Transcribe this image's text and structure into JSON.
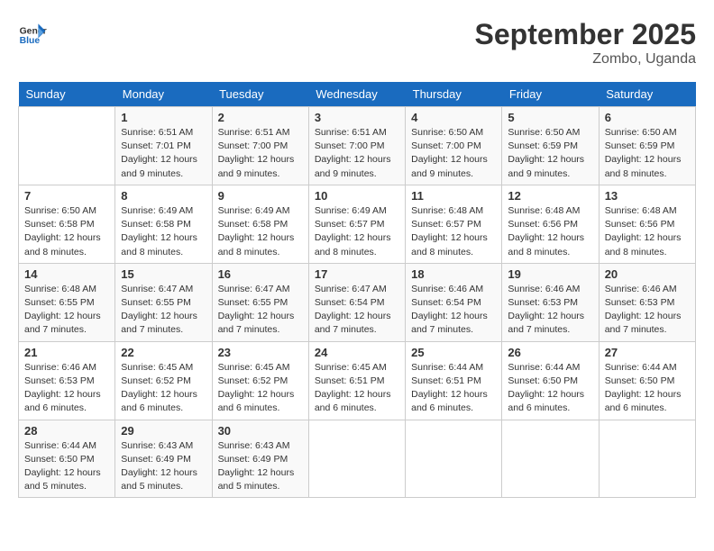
{
  "header": {
    "logo_line1": "General",
    "logo_line2": "Blue",
    "month_title": "September 2025",
    "location": "Zombo, Uganda"
  },
  "days_of_week": [
    "Sunday",
    "Monday",
    "Tuesday",
    "Wednesday",
    "Thursday",
    "Friday",
    "Saturday"
  ],
  "weeks": [
    [
      {
        "day": "",
        "info": ""
      },
      {
        "day": "1",
        "info": "Sunrise: 6:51 AM\nSunset: 7:01 PM\nDaylight: 12 hours\nand 9 minutes."
      },
      {
        "day": "2",
        "info": "Sunrise: 6:51 AM\nSunset: 7:00 PM\nDaylight: 12 hours\nand 9 minutes."
      },
      {
        "day": "3",
        "info": "Sunrise: 6:51 AM\nSunset: 7:00 PM\nDaylight: 12 hours\nand 9 minutes."
      },
      {
        "day": "4",
        "info": "Sunrise: 6:50 AM\nSunset: 7:00 PM\nDaylight: 12 hours\nand 9 minutes."
      },
      {
        "day": "5",
        "info": "Sunrise: 6:50 AM\nSunset: 6:59 PM\nDaylight: 12 hours\nand 9 minutes."
      },
      {
        "day": "6",
        "info": "Sunrise: 6:50 AM\nSunset: 6:59 PM\nDaylight: 12 hours\nand 8 minutes."
      }
    ],
    [
      {
        "day": "7",
        "info": "Sunrise: 6:50 AM\nSunset: 6:58 PM\nDaylight: 12 hours\nand 8 minutes."
      },
      {
        "day": "8",
        "info": "Sunrise: 6:49 AM\nSunset: 6:58 PM\nDaylight: 12 hours\nand 8 minutes."
      },
      {
        "day": "9",
        "info": "Sunrise: 6:49 AM\nSunset: 6:58 PM\nDaylight: 12 hours\nand 8 minutes."
      },
      {
        "day": "10",
        "info": "Sunrise: 6:49 AM\nSunset: 6:57 PM\nDaylight: 12 hours\nand 8 minutes."
      },
      {
        "day": "11",
        "info": "Sunrise: 6:48 AM\nSunset: 6:57 PM\nDaylight: 12 hours\nand 8 minutes."
      },
      {
        "day": "12",
        "info": "Sunrise: 6:48 AM\nSunset: 6:56 PM\nDaylight: 12 hours\nand 8 minutes."
      },
      {
        "day": "13",
        "info": "Sunrise: 6:48 AM\nSunset: 6:56 PM\nDaylight: 12 hours\nand 8 minutes."
      }
    ],
    [
      {
        "day": "14",
        "info": "Sunrise: 6:48 AM\nSunset: 6:55 PM\nDaylight: 12 hours\nand 7 minutes."
      },
      {
        "day": "15",
        "info": "Sunrise: 6:47 AM\nSunset: 6:55 PM\nDaylight: 12 hours\nand 7 minutes."
      },
      {
        "day": "16",
        "info": "Sunrise: 6:47 AM\nSunset: 6:55 PM\nDaylight: 12 hours\nand 7 minutes."
      },
      {
        "day": "17",
        "info": "Sunrise: 6:47 AM\nSunset: 6:54 PM\nDaylight: 12 hours\nand 7 minutes."
      },
      {
        "day": "18",
        "info": "Sunrise: 6:46 AM\nSunset: 6:54 PM\nDaylight: 12 hours\nand 7 minutes."
      },
      {
        "day": "19",
        "info": "Sunrise: 6:46 AM\nSunset: 6:53 PM\nDaylight: 12 hours\nand 7 minutes."
      },
      {
        "day": "20",
        "info": "Sunrise: 6:46 AM\nSunset: 6:53 PM\nDaylight: 12 hours\nand 7 minutes."
      }
    ],
    [
      {
        "day": "21",
        "info": "Sunrise: 6:46 AM\nSunset: 6:53 PM\nDaylight: 12 hours\nand 6 minutes."
      },
      {
        "day": "22",
        "info": "Sunrise: 6:45 AM\nSunset: 6:52 PM\nDaylight: 12 hours\nand 6 minutes."
      },
      {
        "day": "23",
        "info": "Sunrise: 6:45 AM\nSunset: 6:52 PM\nDaylight: 12 hours\nand 6 minutes."
      },
      {
        "day": "24",
        "info": "Sunrise: 6:45 AM\nSunset: 6:51 PM\nDaylight: 12 hours\nand 6 minutes."
      },
      {
        "day": "25",
        "info": "Sunrise: 6:44 AM\nSunset: 6:51 PM\nDaylight: 12 hours\nand 6 minutes."
      },
      {
        "day": "26",
        "info": "Sunrise: 6:44 AM\nSunset: 6:50 PM\nDaylight: 12 hours\nand 6 minutes."
      },
      {
        "day": "27",
        "info": "Sunrise: 6:44 AM\nSunset: 6:50 PM\nDaylight: 12 hours\nand 6 minutes."
      }
    ],
    [
      {
        "day": "28",
        "info": "Sunrise: 6:44 AM\nSunset: 6:50 PM\nDaylight: 12 hours\nand 5 minutes."
      },
      {
        "day": "29",
        "info": "Sunrise: 6:43 AM\nSunset: 6:49 PM\nDaylight: 12 hours\nand 5 minutes."
      },
      {
        "day": "30",
        "info": "Sunrise: 6:43 AM\nSunset: 6:49 PM\nDaylight: 12 hours\nand 5 minutes."
      },
      {
        "day": "",
        "info": ""
      },
      {
        "day": "",
        "info": ""
      },
      {
        "day": "",
        "info": ""
      },
      {
        "day": "",
        "info": ""
      }
    ]
  ]
}
